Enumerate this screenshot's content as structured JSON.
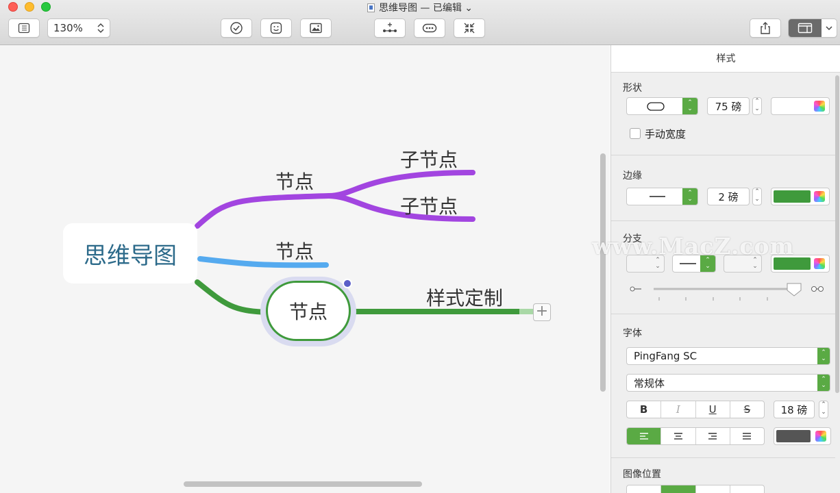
{
  "window": {
    "title": "思维导图 — 已编辑 ⌄"
  },
  "toolbar": {
    "zoom_value": "130%",
    "zoom_stepper": "⌃⌄"
  },
  "canvas": {
    "central_topic": "思维导图",
    "branches": [
      {
        "label": "节点",
        "color": "#a245e0",
        "children": [
          "子节点",
          "子节点"
        ]
      },
      {
        "label": "节点",
        "color": "#55aaef",
        "children": []
      },
      {
        "label": "节点",
        "color": "#3f9a3c",
        "children": [
          "样式定制"
        ],
        "selected": true
      }
    ],
    "add_button": "+"
  },
  "inspector": {
    "tab": "样式",
    "shape": {
      "title": "形状",
      "size_value": "75 磅",
      "manual_width_label": "手动宽度"
    },
    "border": {
      "title": "边缘",
      "width_value": "2 磅",
      "color": "#3f9a3c"
    },
    "branch": {
      "title": "分支",
      "color": "#3f9a3c"
    },
    "font": {
      "title": "字体",
      "family": "PingFang SC",
      "style": "常规体",
      "bold": "B",
      "italic": "I",
      "underline": "U",
      "strike": "S",
      "size_value": "18 磅",
      "color": "#555555"
    },
    "image_position": {
      "title": "图像位置"
    }
  },
  "watermark": "www.MacZ.com"
}
